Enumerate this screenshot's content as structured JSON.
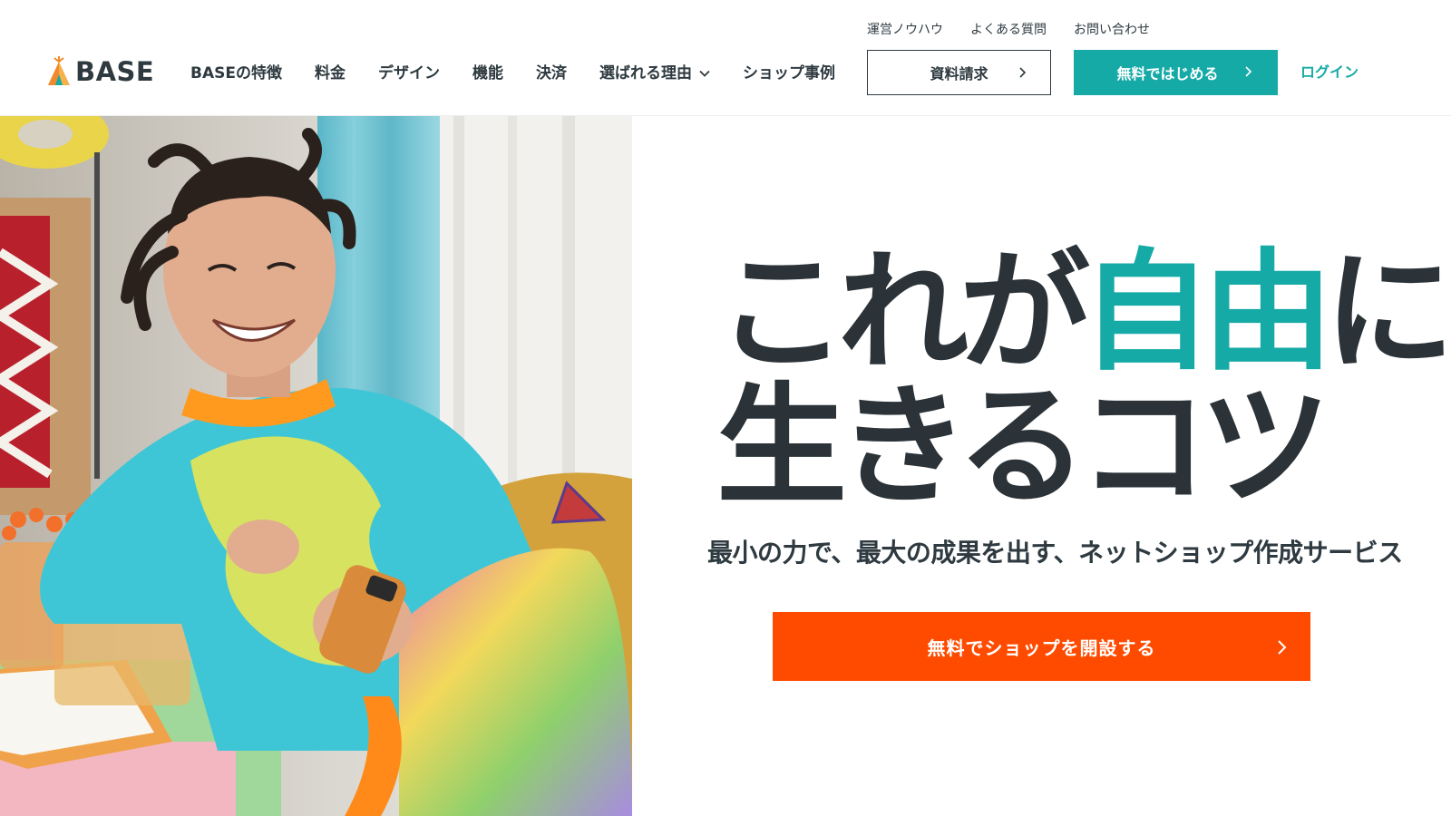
{
  "brand": {
    "name": "BASE",
    "teal": "#16aaa7",
    "orange": "#ff4b00",
    "ink": "#2e3a40"
  },
  "header": {
    "subnav": [
      "運営ノウハウ",
      "よくある質問",
      "お問い合わせ"
    ],
    "nav": [
      "BASEの特徴",
      "料金",
      "デザイン",
      "機能",
      "決済",
      "選ばれる理由",
      "ショップ事例"
    ],
    "doc_button": "資料請求",
    "free_button": "無料ではじめる",
    "login": "ログイン"
  },
  "hero": {
    "headline_part1": "これが",
    "headline_accent": "自由",
    "headline_part2": "に",
    "headline_line2": "生きるコツ",
    "subcopy": "最小の力で、最大の成果を出す、ネットショップ作成サービス",
    "cta": "無料でショップを開設する",
    "photo_icon": "person-with-smartphone-photo"
  }
}
